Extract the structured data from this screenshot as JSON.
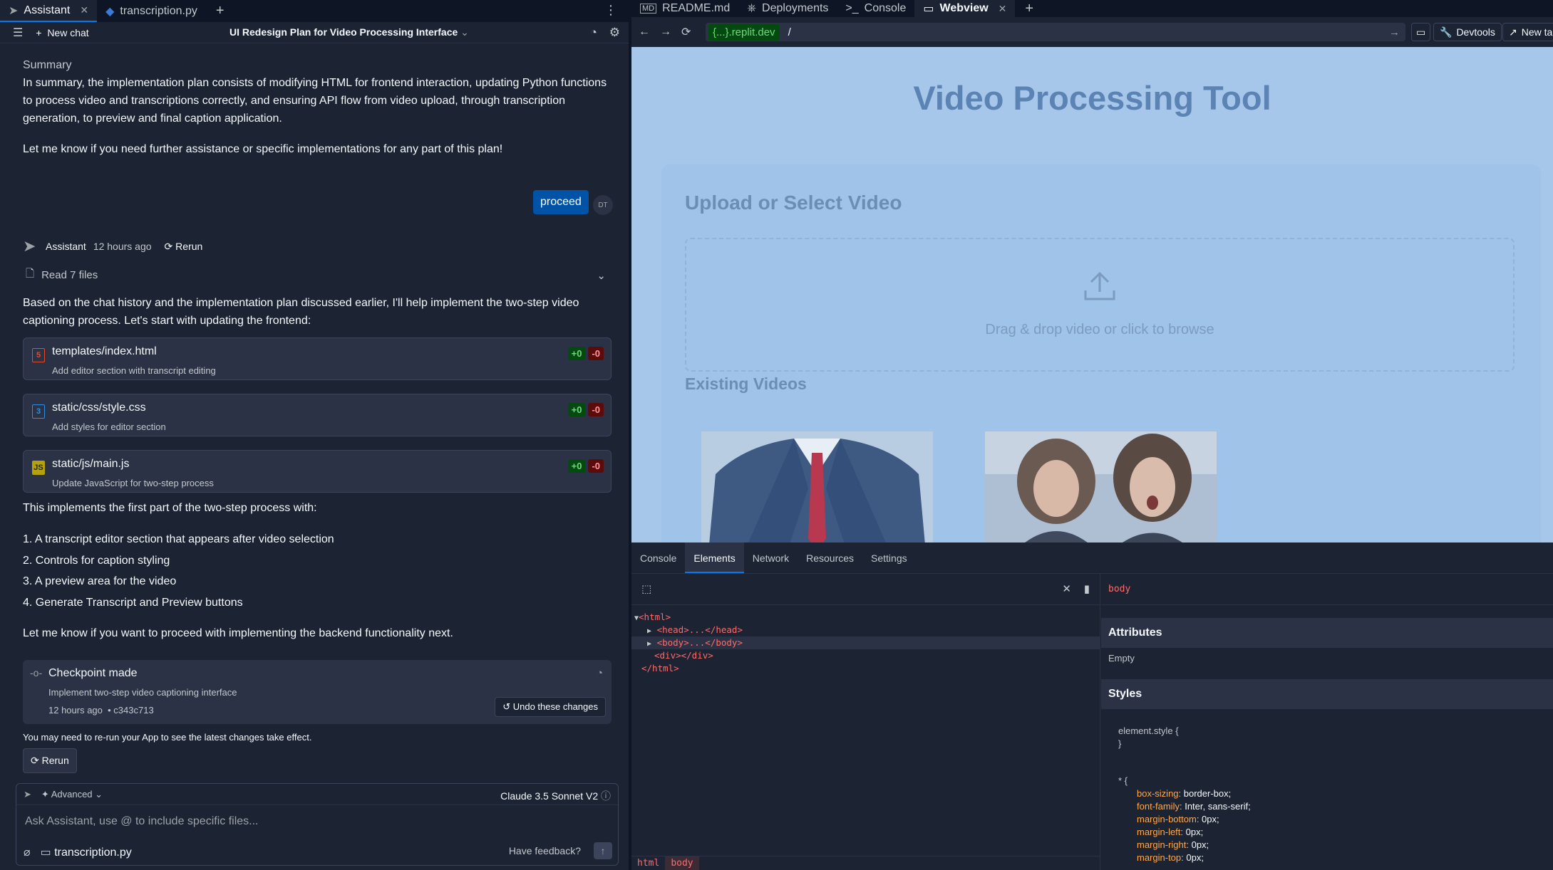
{
  "left_tabs": [
    {
      "label": "Assistant",
      "active": true
    },
    {
      "label": "transcription.py",
      "active": false
    }
  ],
  "chat_header": {
    "new_chat": "New chat",
    "title": "UI Redesign Plan for Video Processing Interface"
  },
  "messages": {
    "summary_heading": "Summary",
    "summary_line1": "In summary, the implementation plan consists of modifying HTML for frontend interaction, updating Python functions",
    "summary_line2": "to process video and transcriptions correctly, and ensuring API flow from video upload, through transcription",
    "summary_line3": "generation, to preview and final caption application.",
    "let_me_know": "Let me know if you need further assistance or specific implementations for any part of this plan!",
    "user_msg": "proceed",
    "user_initials": "DT",
    "assistant_name": "Assistant",
    "assistant_time": "12 hours ago",
    "rerun": "Rerun",
    "read_files": "Read 7 files",
    "intro_line1": "Based on the chat history and the implementation plan discussed earlier, I'll help implement the two-step video",
    "intro_line2": "captioning process. Let's start with updating the frontend:",
    "files": [
      {
        "name": "templates/index.html",
        "desc": "Add editor section with transcript editing",
        "add": "+0",
        "del": "-0",
        "icon": "5",
        "color": "#e34c26"
      },
      {
        "name": "static/css/style.css",
        "desc": "Add styles for editor section",
        "add": "+0",
        "del": "-0",
        "icon": "3",
        "color": "#1572b6"
      },
      {
        "name": "static/js/main.js",
        "desc": "Update JavaScript for two-step process",
        "add": "+0",
        "del": "-0",
        "icon": "JS",
        "color": "#b5a20a"
      }
    ],
    "implements": "This implements the first part of the two-step process with:",
    "list": [
      "1. A transcript editor section that appears after video selection",
      "2. Controls for caption styling",
      "3. A preview area for the video",
      "4. Generate Transcript and Preview buttons"
    ],
    "proceed_backend": "Let me know if you want to proceed with implementing the backend functionality next.",
    "checkpoint": {
      "title": "Checkpoint made",
      "desc": "Implement two-step video captioning interface",
      "time": "12 hours ago",
      "hash": "• c343c713",
      "undo": "Undo these changes"
    },
    "rerun_note": "You may need to re-run your App to see the latest changes take effect.",
    "rerun_button": "Rerun"
  },
  "input": {
    "advanced": "Advanced",
    "model": "Claude 3.5 Sonnet V2",
    "placeholder": "Ask Assistant, use @ to include specific files...",
    "file_chip": "transcription.py",
    "feedback": "Have feedback?"
  },
  "right_tabs": [
    {
      "label": "README.md",
      "active": false
    },
    {
      "label": "Deployments",
      "active": false
    },
    {
      "label": "Console",
      "active": false
    },
    {
      "label": "Webview",
      "active": true
    }
  ],
  "url": {
    "domain": "{...}.replit.dev",
    "path": "/",
    "devtools": "Devtools",
    "new_tab": "New tab"
  },
  "webview": {
    "title": "Video Processing Tool",
    "upload_heading": "Upload or Select Video",
    "dropzone_text": "Drag & drop video or click to browse",
    "existing": "Existing Videos"
  },
  "devtools": {
    "tabs": [
      "Console",
      "Elements",
      "Network",
      "Resources",
      "Settings"
    ],
    "active_tab": "Elements",
    "dom": {
      "html_open": "<html>",
      "head": "<head>...</head>",
      "body": "<body>...</body>",
      "div": "<div></div>",
      "html_close": "</html>"
    },
    "breadcrumb": [
      "html",
      "body"
    ],
    "selected": "body",
    "attributes_heading": "Attributes",
    "attributes_value": "Empty",
    "styles_heading": "Styles",
    "element_style_open": "element.style {",
    "element_style_close": "}",
    "rule_selector": "* {",
    "rules": [
      {
        "prop": "box-sizing",
        "val": "border-box;"
      },
      {
        "prop": "font-family",
        "val": "Inter, sans-serif;"
      },
      {
        "prop": "margin-bottom",
        "val": "0px;"
      },
      {
        "prop": "margin-left",
        "val": "0px;"
      },
      {
        "prop": "margin-right",
        "val": "0px;"
      },
      {
        "prop": "margin-top",
        "val": "0px;"
      }
    ]
  }
}
